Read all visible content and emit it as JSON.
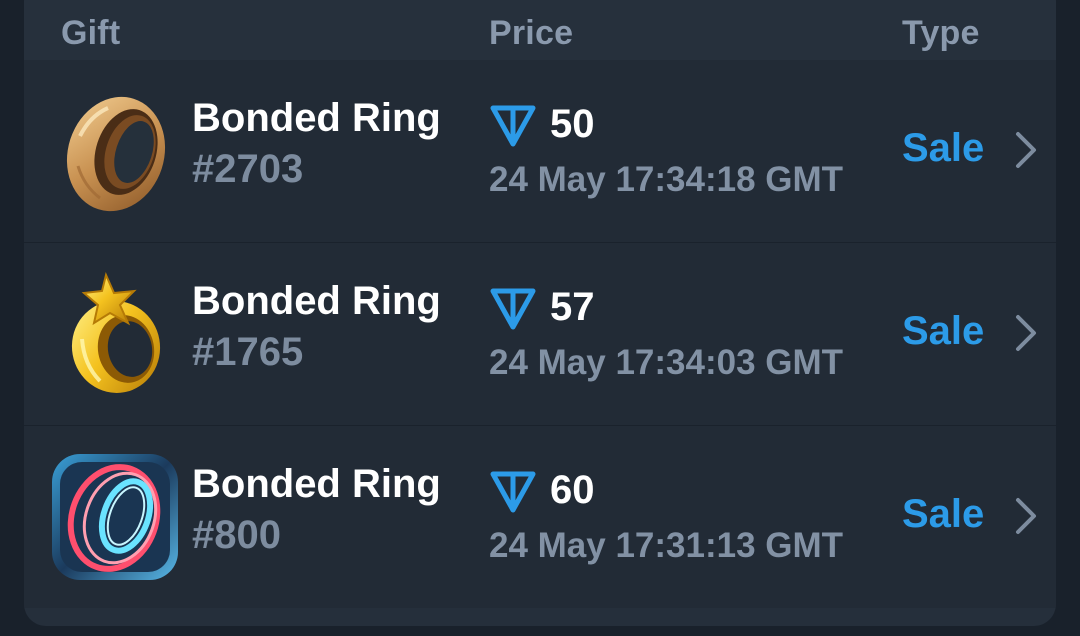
{
  "header": {
    "gift_label": "Gift",
    "price_label": "Price",
    "type_label": "Type"
  },
  "colors": {
    "accent": "#2c9be8",
    "panel": "#252f3b",
    "row": "#222b36",
    "muted_text": "#8291a4"
  },
  "rows": [
    {
      "icon": "wooden-ring-icon",
      "name": "Bonded Ring",
      "number": "#2703",
      "price": "50",
      "time": "24 May 17:34:18 GMT",
      "type": "Sale"
    },
    {
      "icon": "gold-star-ring-icon",
      "name": "Bonded Ring",
      "number": "#1765",
      "price": "57",
      "time": "24 May 17:34:03 GMT",
      "type": "Sale"
    },
    {
      "icon": "neon-ring-icon",
      "name": "Bonded Ring",
      "number": "#800",
      "price": "60",
      "time": "24 May 17:31:13 GMT",
      "type": "Sale"
    }
  ]
}
